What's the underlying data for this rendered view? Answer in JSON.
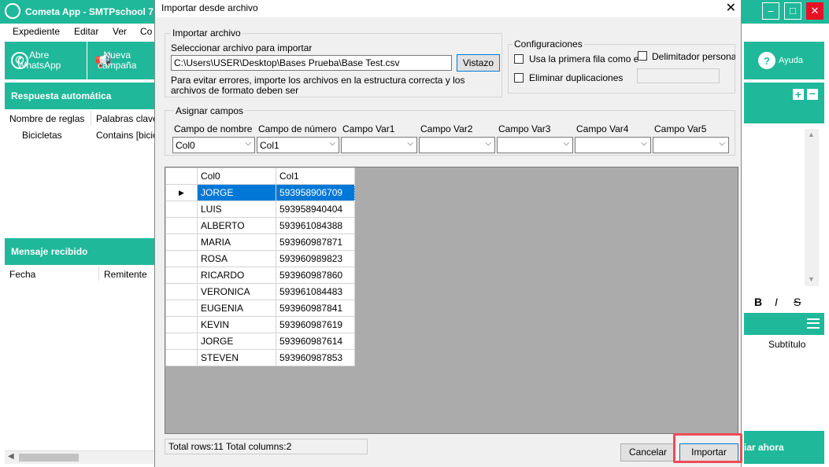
{
  "app": {
    "title": "Cometa App - SMTPschool 7",
    "menu": [
      "Expediente",
      "Editar",
      "Ver",
      "Co"
    ],
    "toolbar": {
      "open_whatsapp_1": "Abre",
      "open_whatsapp_2": "WhatsApp",
      "new_campaign_1": "Nueva",
      "new_campaign_2": "campaña",
      "help": "Ayuda"
    },
    "auto_reply": {
      "header": "Respuesta automática",
      "col_rules": "Nombre de reglas",
      "col_keywords": "Palabras clave",
      "row_rule": "Bicicletas",
      "row_keyword": "Contains [bicicle"
    },
    "received": {
      "header": "Mensaje recibido",
      "col_date": "Fecha",
      "col_sender": "Remitente"
    },
    "right": {
      "bold": "B",
      "italic": "I",
      "strike": "S",
      "subtitle": "Subtítulo",
      "send_now": "iar ahora"
    }
  },
  "dialog": {
    "title": "Importar desde archivo",
    "import_group": "Importar archivo",
    "select_label": "Seleccionar archivo para importar",
    "file_path": "C:\\Users\\USER\\Desktop\\Bases Prueba\\Base Test.csv",
    "preview_button": "Vistazo",
    "hint_line1": "Para evitar errores, importe los archivos en la estructura correcta y los",
    "hint_line2": "archivos de formato deben ser",
    "config_group": "Configuraciones",
    "first_row_header": "Usa la primera fila como enca",
    "custom_delimiter": "Delimitador personaliz",
    "remove_duplicates": "Eliminar duplicaciones",
    "assign_group": "Asignar campos",
    "fields": [
      {
        "label": "Campo de nombre",
        "value": "Col0"
      },
      {
        "label": "Campo de número",
        "value": "Col1"
      },
      {
        "label": "Campo Var1",
        "value": ""
      },
      {
        "label": "Campo Var2",
        "value": ""
      },
      {
        "label": "Campo Var3",
        "value": ""
      },
      {
        "label": "Campo Var4",
        "value": ""
      },
      {
        "label": "Campo Var5",
        "value": ""
      }
    ],
    "grid": {
      "columns": [
        "Col0",
        "Col1"
      ],
      "rows": [
        [
          "JORGE",
          "593958906709"
        ],
        [
          "LUIS",
          "593958940404"
        ],
        [
          "ALBERTO",
          "593961084388"
        ],
        [
          "MARIA",
          "593960987871"
        ],
        [
          "ROSA",
          "593960989823"
        ],
        [
          "RICARDO",
          "593960987860"
        ],
        [
          "VERONICA",
          "593961084483"
        ],
        [
          "EUGENIA",
          "593960987841"
        ],
        [
          "KEVIN",
          "593960987619"
        ],
        [
          "JORGE",
          "593960987614"
        ],
        [
          "STEVEN",
          "593960987853"
        ]
      ]
    },
    "status_text": "Total rows:11  Total columns:2",
    "cancel_button": "Cancelar",
    "import_button": "Importar"
  },
  "colors": {
    "accent": "#1fb89a",
    "selection": "#0078d7",
    "highlight": "#ef4b58"
  }
}
